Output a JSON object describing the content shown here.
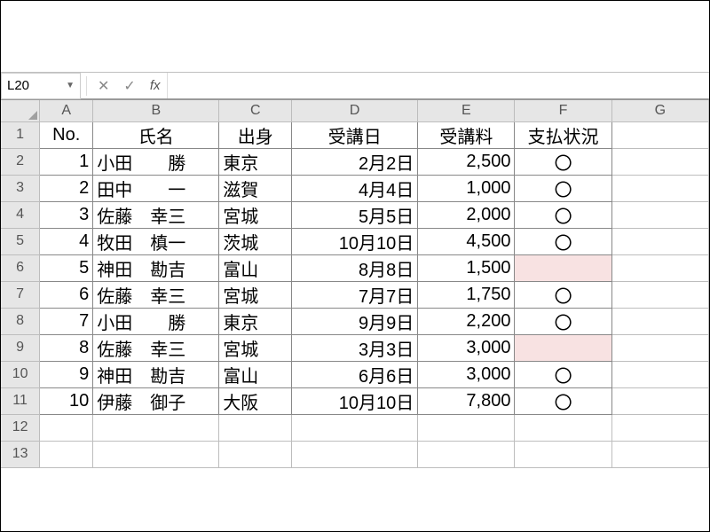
{
  "name_box": {
    "value": "L20"
  },
  "formula_bar": {
    "fx_label": "fx",
    "value": ""
  },
  "columns": [
    "A",
    "B",
    "C",
    "D",
    "E",
    "F",
    "G"
  ],
  "row_numbers": [
    "1",
    "2",
    "3",
    "4",
    "5",
    "6",
    "7",
    "8",
    "9",
    "10",
    "11",
    "12",
    "13"
  ],
  "headers": {
    "no": "No.",
    "name": "氏名",
    "origin": "出身",
    "date": "受講日",
    "fee": "受講料",
    "status": "支払状況"
  },
  "rows": [
    {
      "no": "1",
      "name": "小田　　勝",
      "origin": "東京",
      "date": "2月2日",
      "fee": "2,500",
      "status": "〇",
      "pink": false
    },
    {
      "no": "2",
      "name": "田中　　一",
      "origin": "滋賀",
      "date": "4月4日",
      "fee": "1,000",
      "status": "〇",
      "pink": false
    },
    {
      "no": "3",
      "name": "佐藤　幸三",
      "origin": "宮城",
      "date": "5月5日",
      "fee": "2,000",
      "status": "〇",
      "pink": false
    },
    {
      "no": "4",
      "name": "牧田　槙一",
      "origin": "茨城",
      "date": "10月10日",
      "fee": "4,500",
      "status": "〇",
      "pink": false
    },
    {
      "no": "5",
      "name": "神田　勘吉",
      "origin": "富山",
      "date": "8月8日",
      "fee": "1,500",
      "status": "",
      "pink": true
    },
    {
      "no": "6",
      "name": "佐藤　幸三",
      "origin": "宮城",
      "date": "7月7日",
      "fee": "1,750",
      "status": "〇",
      "pink": false
    },
    {
      "no": "7",
      "name": "小田　　勝",
      "origin": "東京",
      "date": "9月9日",
      "fee": "2,200",
      "status": "〇",
      "pink": false
    },
    {
      "no": "8",
      "name": "佐藤　幸三",
      "origin": "宮城",
      "date": "3月3日",
      "fee": "3,000",
      "status": "",
      "pink": true
    },
    {
      "no": "9",
      "name": "神田　勘吉",
      "origin": "富山",
      "date": "6月6日",
      "fee": "3,000",
      "status": "〇",
      "pink": false
    },
    {
      "no": "10",
      "name": "伊藤　御子",
      "origin": "大阪",
      "date": "10月10日",
      "fee": "7,800",
      "status": "〇",
      "pink": false
    }
  ]
}
